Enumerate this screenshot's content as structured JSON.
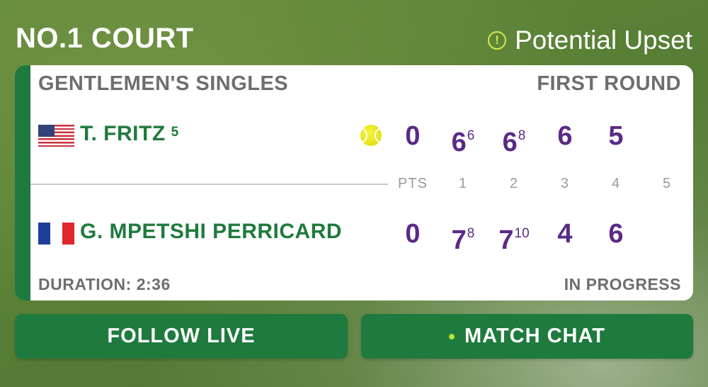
{
  "court": "NO.1 COURT",
  "alert": {
    "label": "Potential Upset",
    "icon": "exclamation-circle-icon",
    "icon_color": "#d7e84a"
  },
  "match": {
    "event": "GENTLEMEN'S SINGLES",
    "round": "FIRST ROUND",
    "duration": "DURATION: 2:36",
    "status": "IN PROGRESS"
  },
  "columns": {
    "pts": "PTS",
    "sets": [
      "1",
      "2",
      "3",
      "4",
      "5"
    ]
  },
  "players": [
    {
      "name": "T. FRITZ",
      "seed": "5",
      "country": "USA",
      "serving": true,
      "points": "0",
      "sets": [
        {
          "games": "6",
          "tiebreak": "6"
        },
        {
          "games": "6",
          "tiebreak": "8"
        },
        {
          "games": "6",
          "tiebreak": ""
        },
        {
          "games": "5",
          "tiebreak": ""
        }
      ]
    },
    {
      "name": "G. MPETSHI PERRICARD",
      "seed": "",
      "country": "FRA",
      "serving": false,
      "points": "0",
      "sets": [
        {
          "games": "7",
          "tiebreak": "8"
        },
        {
          "games": "7",
          "tiebreak": "10"
        },
        {
          "games": "4",
          "tiebreak": ""
        },
        {
          "games": "6",
          "tiebreak": ""
        }
      ]
    }
  ],
  "buttons": {
    "follow_live": "FOLLOW LIVE",
    "match_chat": "MATCH CHAT"
  },
  "colors": {
    "brand_green": "#1f7a3d",
    "score_purple": "#5b2a86",
    "accent_lime": "#b9e23a"
  }
}
